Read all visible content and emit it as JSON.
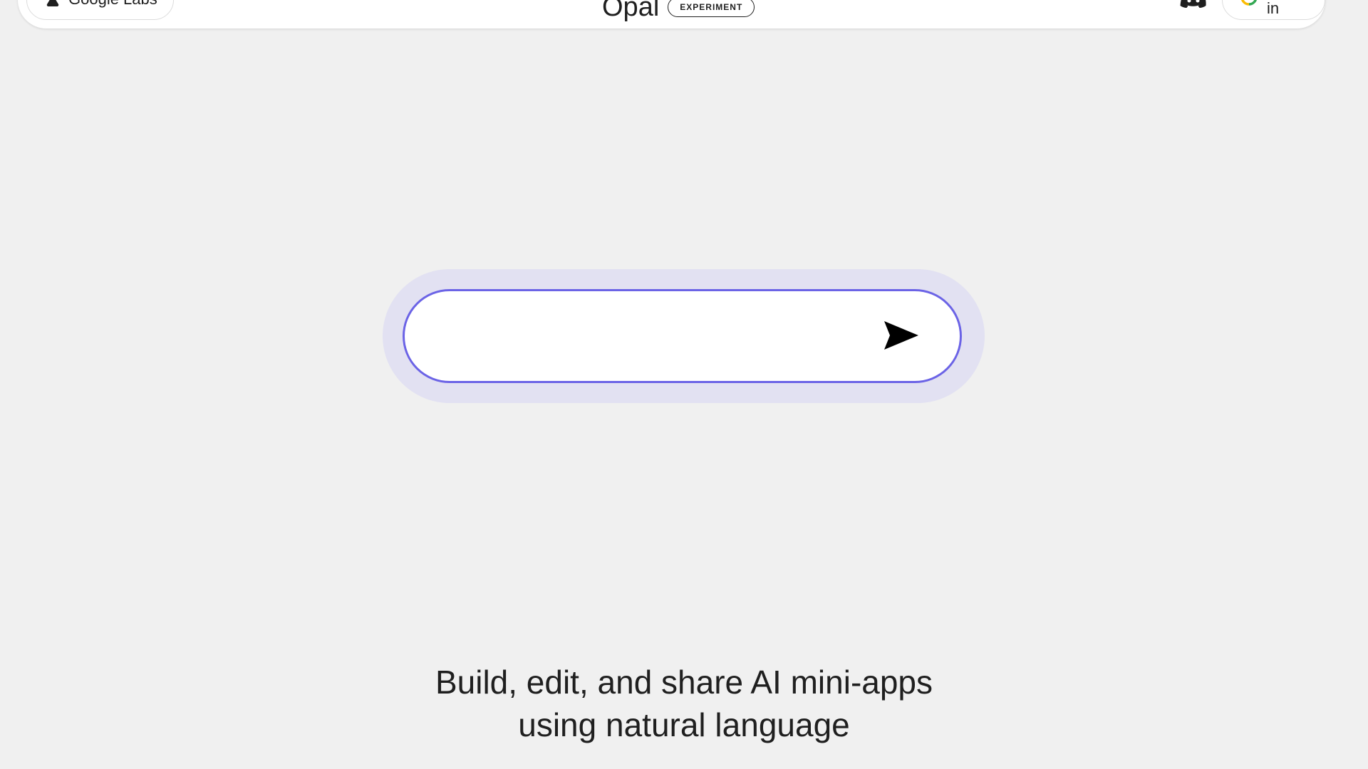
{
  "header": {
    "labs_label": "Google Labs",
    "brand_name": "Opal",
    "badge_label": "EXPERIMENT",
    "discord_icon": "discord-icon",
    "signin_label": "Sign in",
    "signin_icon": "google-g-icon"
  },
  "prompt": {
    "value": "",
    "placeholder": "",
    "send_icon": "send-icon"
  },
  "tagline": {
    "line1": "Build, edit, and share AI mini-apps",
    "line2": "using natural language"
  },
  "colors": {
    "background": "#f0f0f0",
    "accent": "#6b63e6",
    "halo": "#e2e1f2"
  }
}
